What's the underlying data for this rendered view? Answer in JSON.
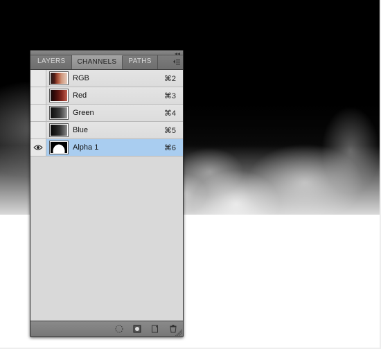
{
  "tabs": {
    "layers": "LAYERS",
    "channels": "CHANNELS",
    "paths": "PATHS"
  },
  "channels": [
    {
      "label": "RGB",
      "shortcut": "⌘2",
      "visible": false,
      "selected": false,
      "thumb": "rgb"
    },
    {
      "label": "Red",
      "shortcut": "⌘3",
      "visible": false,
      "selected": false,
      "thumb": "red"
    },
    {
      "label": "Green",
      "shortcut": "⌘4",
      "visible": false,
      "selected": false,
      "thumb": "green"
    },
    {
      "label": "Blue",
      "shortcut": "⌘5",
      "visible": false,
      "selected": false,
      "thumb": "blue"
    },
    {
      "label": "Alpha 1",
      "shortcut": "⌘6",
      "visible": true,
      "selected": true,
      "thumb": "alpha"
    }
  ],
  "footer_buttons": {
    "load_selection": "load-selection-icon",
    "save_selection": "save-selection-icon",
    "new_channel": "new-channel-icon",
    "delete_channel": "delete-channel-icon"
  }
}
